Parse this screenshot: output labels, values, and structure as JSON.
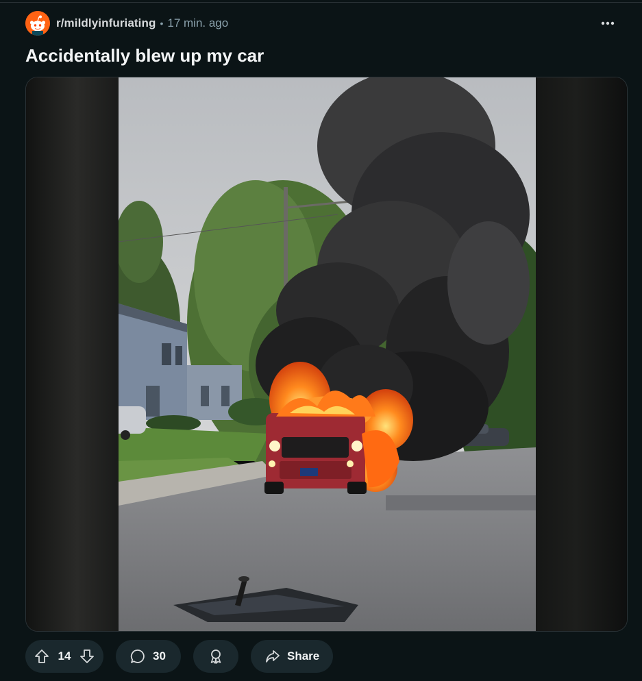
{
  "post": {
    "subreddit": "r/mildlyinfuriating",
    "separator": "•",
    "time_ago": "17 min. ago",
    "title": "Accidentally blew up my car"
  },
  "actions": {
    "vote_count": "14",
    "comment_count": "30",
    "share_label": "Share"
  },
  "icons": {
    "avatar": "reddit-snoo-icon",
    "more": "ellipsis-horizontal-icon",
    "upvote": "arrow-up-icon",
    "downvote": "arrow-down-icon",
    "comment": "speech-bubble-icon",
    "award": "award-ribbon-icon",
    "share": "share-arrow-icon"
  },
  "colors": {
    "background": "#0b1416",
    "pill": "#1a282d",
    "accent": "#ff6314",
    "muted_text": "#8ba2ad"
  }
}
